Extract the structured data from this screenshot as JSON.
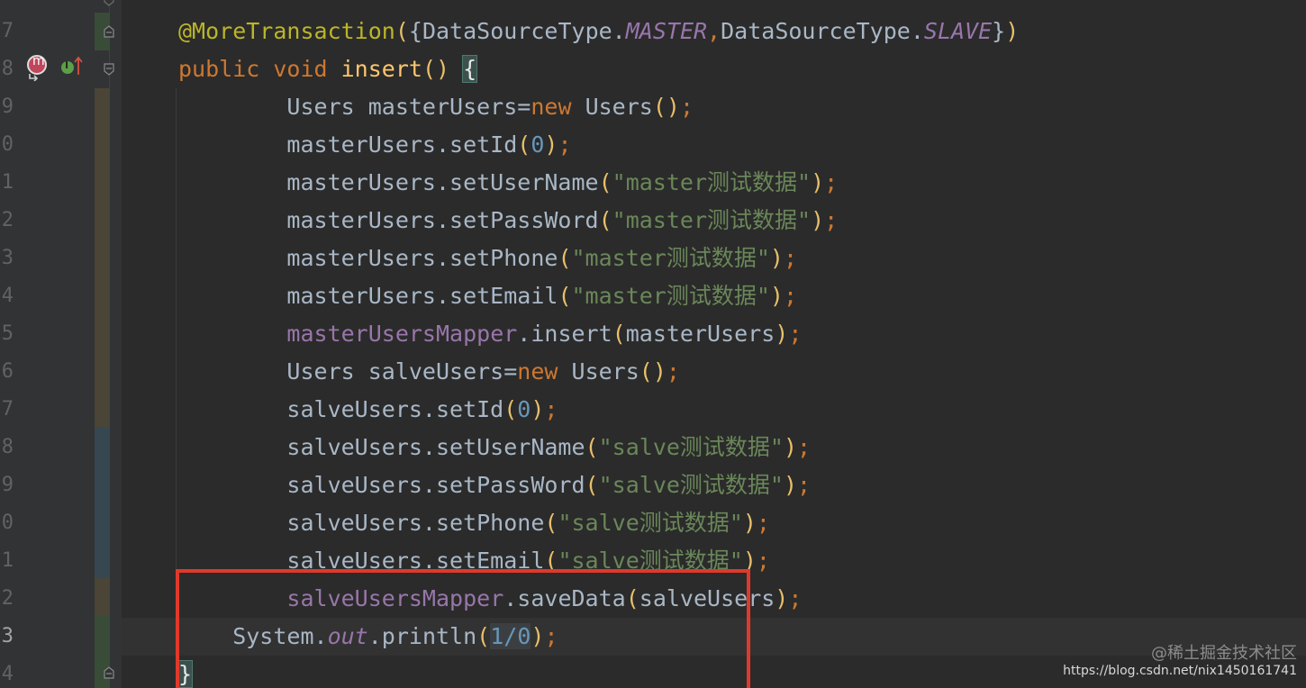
{
  "editor": {
    "lines": [
      {
        "number": "7",
        "segments": [
          {
            "t": "@MoreTransaction",
            "c": "ann"
          },
          {
            "t": "(",
            "c": "paren"
          },
          {
            "t": "{",
            "c": "plain"
          },
          {
            "t": "DataSourceType.",
            "c": "plain"
          },
          {
            "t": "MASTER",
            "c": "static-i"
          },
          {
            "t": ",",
            "c": "kw"
          },
          {
            "t": "DataSourceType.",
            "c": "plain"
          },
          {
            "t": "SLAVE",
            "c": "static-i"
          },
          {
            "t": "}",
            "c": "plain"
          },
          {
            "t": ")",
            "c": "paren"
          }
        ]
      },
      {
        "number": "8",
        "segments": [
          {
            "t": "public void ",
            "c": "kw"
          },
          {
            "t": "insert",
            "c": "fn"
          },
          {
            "t": "() ",
            "c": "paren"
          },
          {
            "t": "{",
            "c": "brace-hl"
          }
        ]
      },
      {
        "number": "9",
        "segments": [
          {
            "t": "        Users masterUsers=",
            "c": "plain"
          },
          {
            "t": "new ",
            "c": "kw"
          },
          {
            "t": "Users",
            "c": "plain"
          },
          {
            "t": "()",
            "c": "paren"
          },
          {
            "t": ";",
            "c": "kw"
          }
        ]
      },
      {
        "number": "0",
        "segments": [
          {
            "t": "        masterUsers.setId",
            "c": "plain"
          },
          {
            "t": "(",
            "c": "paren"
          },
          {
            "t": "0",
            "c": "num"
          },
          {
            "t": ")",
            "c": "paren"
          },
          {
            "t": ";",
            "c": "kw"
          }
        ]
      },
      {
        "number": "1",
        "segments": [
          {
            "t": "        masterUsers.setUserName",
            "c": "plain"
          },
          {
            "t": "(",
            "c": "paren"
          },
          {
            "t": "\"master测试数据\"",
            "c": "str"
          },
          {
            "t": ")",
            "c": "paren"
          },
          {
            "t": ";",
            "c": "kw"
          }
        ]
      },
      {
        "number": "2",
        "segments": [
          {
            "t": "        masterUsers.setPassWord",
            "c": "plain"
          },
          {
            "t": "(",
            "c": "paren"
          },
          {
            "t": "\"master测试数据\"",
            "c": "str"
          },
          {
            "t": ")",
            "c": "paren"
          },
          {
            "t": ";",
            "c": "kw"
          }
        ]
      },
      {
        "number": "3",
        "segments": [
          {
            "t": "        masterUsers.setPhone",
            "c": "plain"
          },
          {
            "t": "(",
            "c": "paren"
          },
          {
            "t": "\"master测试数据\"",
            "c": "str"
          },
          {
            "t": ")",
            "c": "paren"
          },
          {
            "t": ";",
            "c": "kw"
          }
        ]
      },
      {
        "number": "4",
        "segments": [
          {
            "t": "        masterUsers.setEmail",
            "c": "plain"
          },
          {
            "t": "(",
            "c": "paren"
          },
          {
            "t": "\"master测试数据\"",
            "c": "str"
          },
          {
            "t": ")",
            "c": "paren"
          },
          {
            "t": ";",
            "c": "kw"
          }
        ]
      },
      {
        "number": "5",
        "segments": [
          {
            "t": "        ",
            "c": "plain"
          },
          {
            "t": "masterUsersMapper",
            "c": "field"
          },
          {
            "t": ".insert",
            "c": "plain"
          },
          {
            "t": "(",
            "c": "paren"
          },
          {
            "t": "masterUsers",
            "c": "plain"
          },
          {
            "t": ")",
            "c": "paren"
          },
          {
            "t": ";",
            "c": "kw"
          }
        ]
      },
      {
        "number": "6",
        "segments": [
          {
            "t": "        Users salveUsers=",
            "c": "plain"
          },
          {
            "t": "new ",
            "c": "kw"
          },
          {
            "t": "Users",
            "c": "plain"
          },
          {
            "t": "()",
            "c": "paren"
          },
          {
            "t": ";",
            "c": "kw"
          }
        ]
      },
      {
        "number": "7",
        "segments": [
          {
            "t": "        salveUsers.setId",
            "c": "plain"
          },
          {
            "t": "(",
            "c": "paren"
          },
          {
            "t": "0",
            "c": "num"
          },
          {
            "t": ")",
            "c": "paren"
          },
          {
            "t": ";",
            "c": "kw"
          }
        ]
      },
      {
        "number": "8",
        "segments": [
          {
            "t": "        salveUsers.setUserName",
            "c": "plain"
          },
          {
            "t": "(",
            "c": "paren"
          },
          {
            "t": "\"salve测试数据\"",
            "c": "str"
          },
          {
            "t": ")",
            "c": "paren"
          },
          {
            "t": ";",
            "c": "kw"
          }
        ]
      },
      {
        "number": "9",
        "segments": [
          {
            "t": "        salveUsers.setPassWord",
            "c": "plain"
          },
          {
            "t": "(",
            "c": "paren"
          },
          {
            "t": "\"salve测试数据\"",
            "c": "str"
          },
          {
            "t": ")",
            "c": "paren"
          },
          {
            "t": ";",
            "c": "kw"
          }
        ]
      },
      {
        "number": "0",
        "segments": [
          {
            "t": "        salveUsers.setPhone",
            "c": "plain"
          },
          {
            "t": "(",
            "c": "paren"
          },
          {
            "t": "\"salve测试数据\"",
            "c": "str"
          },
          {
            "t": ")",
            "c": "paren"
          },
          {
            "t": ";",
            "c": "kw"
          }
        ]
      },
      {
        "number": "1",
        "segments": [
          {
            "t": "        salveUsers.setEmail",
            "c": "plain"
          },
          {
            "t": "(",
            "c": "paren"
          },
          {
            "t": "\"salve测试数据\"",
            "c": "str"
          },
          {
            "t": ")",
            "c": "paren"
          },
          {
            "t": ";",
            "c": "kw"
          }
        ]
      },
      {
        "number": "2",
        "segments": [
          {
            "t": "        ",
            "c": "plain"
          },
          {
            "t": "salveUsersMapper",
            "c": "field"
          },
          {
            "t": ".saveData",
            "c": "plain"
          },
          {
            "t": "(",
            "c": "paren"
          },
          {
            "t": "salveUsers",
            "c": "plain"
          },
          {
            "t": ")",
            "c": "paren"
          },
          {
            "t": ";",
            "c": "kw"
          }
        ]
      },
      {
        "number": "3",
        "current": true,
        "segments": [
          {
            "t": "    System.",
            "c": "plain"
          },
          {
            "t": "out",
            "c": "static-i"
          },
          {
            "t": ".println",
            "c": "plain"
          },
          {
            "t": "(",
            "c": "paren"
          },
          {
            "t": "1/0",
            "c": "num-hl"
          },
          {
            "t": ")",
            "c": "paren"
          },
          {
            "t": ";",
            "c": "kw"
          }
        ]
      },
      {
        "number": "4",
        "segments": [
          {
            "t": "}",
            "c": "brace-hl"
          }
        ]
      }
    ]
  },
  "gutter_icons": [
    "method-implementation-icon",
    "implements-interface-icon"
  ],
  "colors": {
    "background": "#2b2b2b",
    "gutter": "#313335",
    "keyword": "#cc7832",
    "string": "#6a8759",
    "number": "#6897bb",
    "annotation": "#bbb529",
    "highlight_box": "#e0392b"
  },
  "watermark": {
    "site": "@稀土掘金技术社区",
    "url": "https://blog.csdn.net/nix1450161741"
  }
}
